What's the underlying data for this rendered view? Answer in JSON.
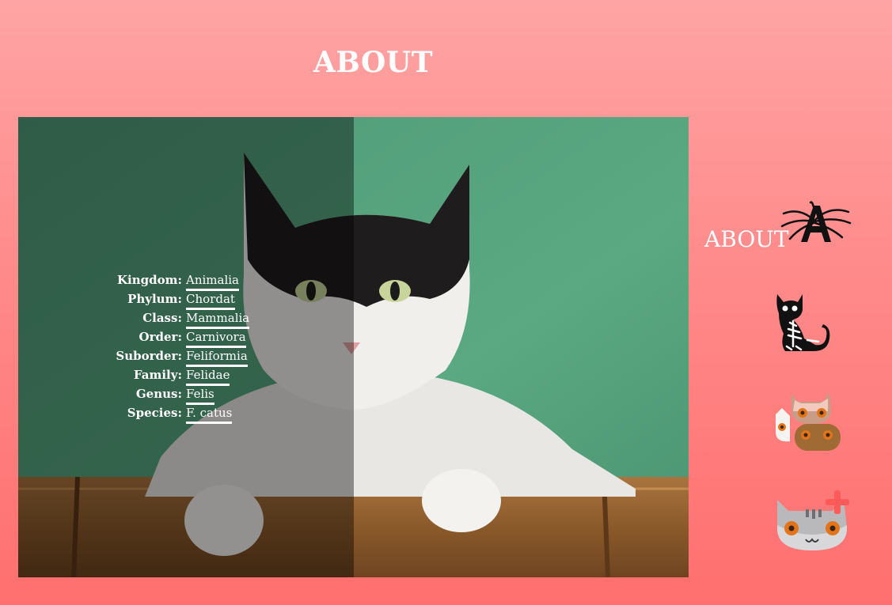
{
  "header": {
    "title": "ABOUT"
  },
  "taxonomy": [
    {
      "label": "Kingdom:",
      "value": "Animalia"
    },
    {
      "label": "Phylum:",
      "value": "Chordat"
    },
    {
      "label": "Class:",
      "value": "Mammalia"
    },
    {
      "label": "Order:",
      "value": "Carnivora"
    },
    {
      "label": "Suborder:",
      "value": "Feliformia"
    },
    {
      "label": "Family:",
      "value": "Felidae"
    },
    {
      "label": "Genus:",
      "value": "Felis"
    },
    {
      "label": "Species:",
      "value": "F. catus"
    }
  ],
  "nav": {
    "about_label": "ABOUT",
    "items": [
      {
        "icon": "spider-letter-a-icon"
      },
      {
        "icon": "skeleton-cat-icon"
      },
      {
        "icon": "cat-couple-icon"
      },
      {
        "icon": "grey-cat-plus-icon"
      }
    ]
  },
  "colors": {
    "background_top": "#ffa4a4",
    "background_bottom": "#ff6f6f",
    "photo_wall": "#52a07b",
    "overlay": "rgba(0,0,0,0.40)",
    "text": "#ffffff",
    "plus_accent": "#ff5a5a"
  }
}
